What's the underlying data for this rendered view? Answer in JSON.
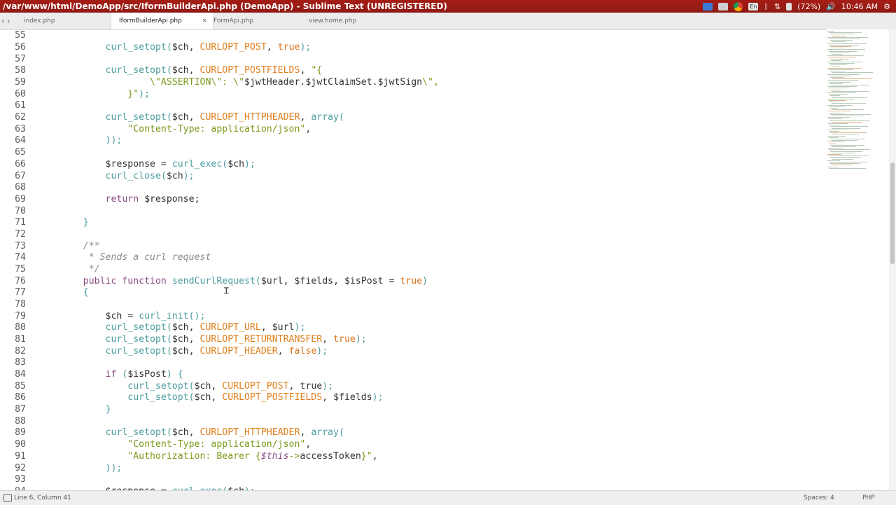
{
  "window": {
    "title": "/var/www/html/DemoApp/src/IformBuilderApi.php (DemoApp) - Sublime Text (UNREGISTERED)"
  },
  "system": {
    "battery": "(72%)",
    "time": "10:46 AM",
    "icons": [
      "dropbox-icon",
      "keyboard-icon",
      "chrome-icon",
      "language-icon",
      "bluetooth-icon",
      "network-icon",
      "battery-icon",
      "volume-icon",
      "power-icon"
    ]
  },
  "tabs": [
    {
      "label": "index.php"
    },
    {
      "label": "IformBuilderApi.php",
      "active": true,
      "close": "×"
    },
    {
      "label": "FormApi.php"
    },
    {
      "label": "view.home.php"
    }
  ],
  "nav": {
    "back": "‹",
    "forward": "›"
  },
  "editor": {
    "lines": [
      {
        "n": "55",
        "s": []
      },
      {
        "n": "56",
        "s": [
          [
            "",
            "        "
          ],
          [
            "fn",
            "curl_setopt("
          ],
          [
            "var",
            "$ch, "
          ],
          [
            "con",
            "CURLOPT_POST"
          ],
          [
            "var",
            ", "
          ],
          [
            "bool",
            "true"
          ],
          [
            "fn",
            ");"
          ]
        ]
      },
      {
        "n": "57",
        "s": []
      },
      {
        "n": "58",
        "s": [
          [
            "",
            "        "
          ],
          [
            "fn",
            "curl_setopt("
          ],
          [
            "var",
            "$ch, "
          ],
          [
            "con",
            "CURLOPT_POSTFIELDS"
          ],
          [
            "var",
            ", "
          ],
          [
            "str",
            "\"{"
          ]
        ]
      },
      {
        "n": "59",
        "s": [
          [
            "",
            "                "
          ],
          [
            "str",
            "\\\"ASSERTION\\\": \\\""
          ],
          [
            "var",
            "$jwtHeader.$jwtClaimSet.$jwtSign"
          ],
          [
            "str",
            "\\\","
          ]
        ]
      },
      {
        "n": "60",
        "s": [
          [
            "",
            "            "
          ],
          [
            "str",
            "}\""
          ],
          [
            "fn",
            ");"
          ]
        ]
      },
      {
        "n": "61",
        "s": []
      },
      {
        "n": "62",
        "s": [
          [
            "",
            "        "
          ],
          [
            "fn",
            "curl_setopt("
          ],
          [
            "var",
            "$ch, "
          ],
          [
            "con",
            "CURLOPT_HTTPHEADER"
          ],
          [
            "var",
            ", "
          ],
          [
            "fn",
            "array("
          ]
        ]
      },
      {
        "n": "63",
        "s": [
          [
            "",
            "            "
          ],
          [
            "str",
            "\"Content-Type: application/json\""
          ],
          [
            "var",
            ","
          ]
        ]
      },
      {
        "n": "64",
        "s": [
          [
            "",
            "        "
          ],
          [
            "fn",
            "));"
          ]
        ]
      },
      {
        "n": "65",
        "s": []
      },
      {
        "n": "66",
        "s": [
          [
            "",
            "        "
          ],
          [
            "var",
            "$response = "
          ],
          [
            "fn",
            "curl_exec("
          ],
          [
            "var",
            "$ch"
          ],
          [
            "fn",
            ");"
          ]
        ]
      },
      {
        "n": "67",
        "s": [
          [
            "",
            "        "
          ],
          [
            "fn",
            "curl_close("
          ],
          [
            "var",
            "$ch"
          ],
          [
            "fn",
            ");"
          ]
        ]
      },
      {
        "n": "68",
        "s": []
      },
      {
        "n": "69",
        "s": [
          [
            "",
            "        "
          ],
          [
            "kw",
            "return "
          ],
          [
            "var",
            "$response;"
          ]
        ]
      },
      {
        "n": "70",
        "s": []
      },
      {
        "n": "71",
        "s": [
          [
            "",
            "    "
          ],
          [
            "pun",
            "}"
          ]
        ]
      },
      {
        "n": "72",
        "s": []
      },
      {
        "n": "73",
        "s": [
          [
            "",
            "    "
          ],
          [
            "cm",
            "/**"
          ]
        ]
      },
      {
        "n": "74",
        "s": [
          [
            "",
            "    "
          ],
          [
            "cm",
            " * Sends a curl request"
          ]
        ]
      },
      {
        "n": "75",
        "s": [
          [
            "",
            "    "
          ],
          [
            "cm",
            " */"
          ]
        ]
      },
      {
        "n": "76",
        "s": [
          [
            "",
            "    "
          ],
          [
            "kw",
            "public function "
          ],
          [
            "fn",
            "sendCurlRequest("
          ],
          [
            "var",
            "$url, $fields, $isPost = "
          ],
          [
            "bool",
            "true"
          ],
          [
            "fn",
            ")"
          ]
        ]
      },
      {
        "n": "77",
        "s": [
          [
            "",
            "    "
          ],
          [
            "pun",
            "{"
          ]
        ]
      },
      {
        "n": "78",
        "s": []
      },
      {
        "n": "79",
        "s": [
          [
            "",
            "        "
          ],
          [
            "var",
            "$ch = "
          ],
          [
            "fn",
            "curl_init();"
          ]
        ]
      },
      {
        "n": "80",
        "s": [
          [
            "",
            "        "
          ],
          [
            "fn",
            "curl_setopt("
          ],
          [
            "var",
            "$ch, "
          ],
          [
            "con",
            "CURLOPT_URL"
          ],
          [
            "var",
            ", $url"
          ],
          [
            "fn",
            ");"
          ]
        ]
      },
      {
        "n": "81",
        "s": [
          [
            "",
            "        "
          ],
          [
            "fn",
            "curl_setopt("
          ],
          [
            "var",
            "$ch, "
          ],
          [
            "con",
            "CURLOPT_RETURNTRANSFER"
          ],
          [
            "var",
            ", "
          ],
          [
            "bool",
            "true"
          ],
          [
            "fn",
            ");"
          ]
        ]
      },
      {
        "n": "82",
        "s": [
          [
            "",
            "        "
          ],
          [
            "fn",
            "curl_setopt("
          ],
          [
            "var",
            "$ch, "
          ],
          [
            "con",
            "CURLOPT_HEADER"
          ],
          [
            "var",
            ", "
          ],
          [
            "bool",
            "false"
          ],
          [
            "fn",
            ");"
          ]
        ]
      },
      {
        "n": "83",
        "s": []
      },
      {
        "n": "84",
        "s": [
          [
            "",
            "        "
          ],
          [
            "kw",
            "if "
          ],
          [
            "fn",
            "("
          ],
          [
            "var",
            "$isPost"
          ],
          [
            "fn",
            ") {"
          ]
        ]
      },
      {
        "n": "85",
        "s": [
          [
            "",
            "            "
          ],
          [
            "fn",
            "curl_setopt("
          ],
          [
            "var",
            "$ch, "
          ],
          [
            "con",
            "CURLOPT_POST"
          ],
          [
            "var",
            ", "
          ],
          [
            "var",
            "true"
          ],
          [
            "fn",
            ");"
          ]
        ]
      },
      {
        "n": "86",
        "s": [
          [
            "",
            "            "
          ],
          [
            "fn",
            "curl_setopt("
          ],
          [
            "var",
            "$ch, "
          ],
          [
            "con",
            "CURLOPT_POSTFIELDS"
          ],
          [
            "var",
            ", $fields"
          ],
          [
            "fn",
            ");"
          ]
        ]
      },
      {
        "n": "87",
        "s": [
          [
            "",
            "        "
          ],
          [
            "pun",
            "}"
          ]
        ]
      },
      {
        "n": "88",
        "s": []
      },
      {
        "n": "89",
        "s": [
          [
            "",
            "        "
          ],
          [
            "fn",
            "curl_setopt("
          ],
          [
            "var",
            "$ch, "
          ],
          [
            "con",
            "CURLOPT_HTTPHEADER"
          ],
          [
            "var",
            ", "
          ],
          [
            "fn",
            "array("
          ]
        ]
      },
      {
        "n": "90",
        "s": [
          [
            "",
            "            "
          ],
          [
            "str",
            "\"Content-Type: application/json\""
          ],
          [
            "var",
            ","
          ]
        ]
      },
      {
        "n": "91",
        "s": [
          [
            "",
            "            "
          ],
          [
            "str",
            "\"Authorization: Bearer {"
          ],
          [
            "this",
            "$this"
          ],
          [
            "str",
            "->"
          ],
          [
            "var",
            "accessToken"
          ],
          [
            "str",
            "}\""
          ],
          [
            "var",
            ","
          ]
        ]
      },
      {
        "n": "92",
        "s": [
          [
            "",
            "        "
          ],
          [
            "fn",
            "));"
          ]
        ]
      },
      {
        "n": "93",
        "s": []
      },
      {
        "n": "94",
        "s": [
          [
            "",
            "        "
          ],
          [
            "var",
            "$response = "
          ],
          [
            "fn",
            "curl_exec("
          ],
          [
            "var",
            "$ch"
          ],
          [
            "fn",
            ");"
          ]
        ]
      }
    ]
  },
  "statusbar": {
    "position": "Line 6, Column 41",
    "spaces": "Spaces: 4",
    "syntax": "PHP"
  },
  "colors": {
    "titlebar": "#a51d15",
    "function": "#4d9c9e",
    "constant": "#e07f1d",
    "string": "#7a9a1a",
    "keyword": "#8a4a82",
    "comment": "#8a8a8a"
  }
}
